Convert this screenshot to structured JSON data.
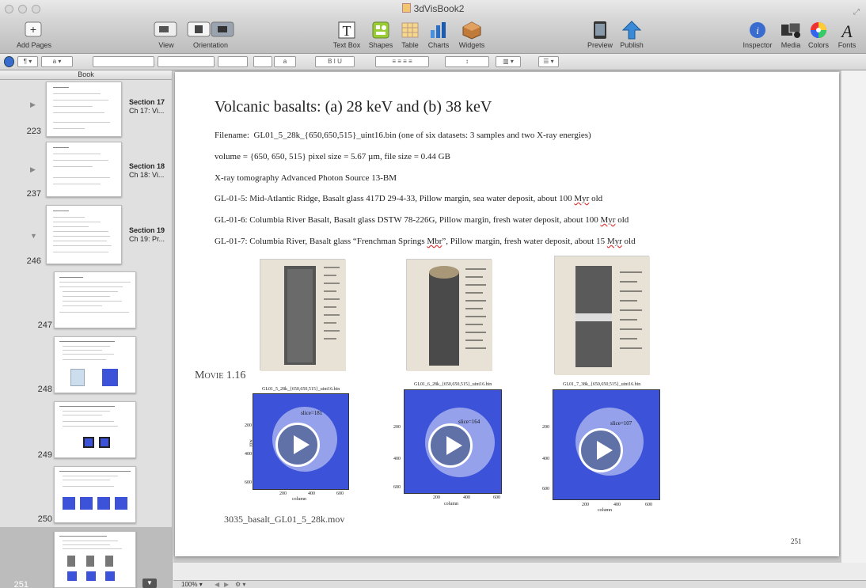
{
  "window": {
    "title": "3dVisBook2"
  },
  "toolbar": {
    "add_pages": "Add Pages",
    "view": "View",
    "orientation": "Orientation",
    "text_box": "Text Box",
    "shapes": "Shapes",
    "table": "Table",
    "charts": "Charts",
    "widgets": "Widgets",
    "preview": "Preview",
    "publish": "Publish",
    "inspector": "Inspector",
    "media": "Media",
    "colors": "Colors",
    "fonts": "Fonts"
  },
  "sidebar": {
    "header": "Book",
    "sections": [
      {
        "page": "223",
        "label": "Section 17",
        "sub": "Ch 17: Vi..."
      },
      {
        "page": "237",
        "label": "Section 18",
        "sub": "Ch 18: Vi..."
      },
      {
        "page": "246",
        "label": "Section 19",
        "sub": "Ch 19: Pr..."
      }
    ],
    "pages": [
      "247",
      "248",
      "249",
      "250",
      "251"
    ]
  },
  "page": {
    "title": "Volcanic basalts: (a) 28 keV and (b) 38 keV",
    "filename_label": "Filename:",
    "filename_value": "GL01_5_28k_{650,650,515}_uint16.bin (one of six datasets: 3 samples and two X-ray energies)",
    "volume_line": "volume = {650, 650, 515} pixel size = 5.67 µm, file size = 0.44 GB",
    "source_line": "X-ray tomography Advanced Photon Source 13-BM",
    "samples": [
      {
        "pre": "GL-01-5: Mid-Atlantic Ridge, Basalt glass 417D 29-4-33, Pillow margin, sea water deposit, about 100 ",
        "u": "Myr",
        "post": " old"
      },
      {
        "pre": "GL-01-6: Columbia River Basalt, Basalt glass DSTW 78-226G, Pillow margin, fresh water deposit, about 100 ",
        "u": "Myr",
        "post": " old"
      },
      {
        "pre": "GL-01-7: Columbia River, Basalt glass “Frenchman Springs ",
        "u": "Mbr",
        "post": "”, Pillow margin, fresh water deposit, about 15 ",
        "u2": "Myr",
        "post2": " old"
      }
    ],
    "movie_label": "Movie 1.16",
    "movies": [
      {
        "title": "GL01_5_28k_{650,650,515}_uint16.bin",
        "slice": "slice=181"
      },
      {
        "title": "GL01_6_28k_{650,650,515}_uint16.bin",
        "slice": "slice=164"
      },
      {
        "title": "GL01_7_38k_{650,650,515}_uint16.bin",
        "slice": "slice=107"
      }
    ],
    "yticks": [
      "200",
      "400",
      "600"
    ],
    "xticks": [
      "200",
      "400",
      "600"
    ],
    "xlabel": "column",
    "ylabel": "row",
    "movie_file": "3035_basalt_GL01_5_28k.mov",
    "page_number": "251"
  },
  "zoom": "100%"
}
